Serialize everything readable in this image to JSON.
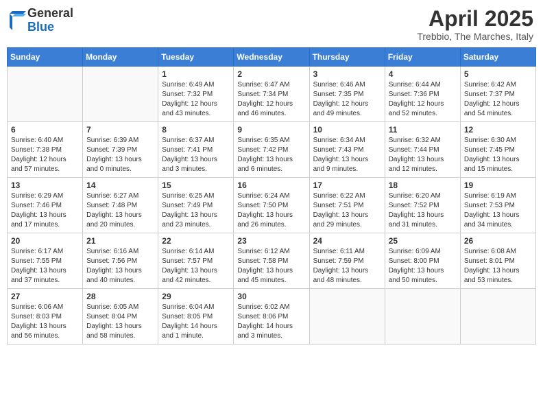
{
  "header": {
    "logo_general": "General",
    "logo_blue": "Blue",
    "month_title": "April 2025",
    "location": "Trebbio, The Marches, Italy"
  },
  "weekdays": [
    "Sunday",
    "Monday",
    "Tuesday",
    "Wednesday",
    "Thursday",
    "Friday",
    "Saturday"
  ],
  "weeks": [
    [
      {
        "day": "",
        "info": ""
      },
      {
        "day": "",
        "info": ""
      },
      {
        "day": "1",
        "info": "Sunrise: 6:49 AM\nSunset: 7:32 PM\nDaylight: 12 hours and 43 minutes."
      },
      {
        "day": "2",
        "info": "Sunrise: 6:47 AM\nSunset: 7:34 PM\nDaylight: 12 hours and 46 minutes."
      },
      {
        "day": "3",
        "info": "Sunrise: 6:46 AM\nSunset: 7:35 PM\nDaylight: 12 hours and 49 minutes."
      },
      {
        "day": "4",
        "info": "Sunrise: 6:44 AM\nSunset: 7:36 PM\nDaylight: 12 hours and 52 minutes."
      },
      {
        "day": "5",
        "info": "Sunrise: 6:42 AM\nSunset: 7:37 PM\nDaylight: 12 hours and 54 minutes."
      }
    ],
    [
      {
        "day": "6",
        "info": "Sunrise: 6:40 AM\nSunset: 7:38 PM\nDaylight: 12 hours and 57 minutes."
      },
      {
        "day": "7",
        "info": "Sunrise: 6:39 AM\nSunset: 7:39 PM\nDaylight: 13 hours and 0 minutes."
      },
      {
        "day": "8",
        "info": "Sunrise: 6:37 AM\nSunset: 7:41 PM\nDaylight: 13 hours and 3 minutes."
      },
      {
        "day": "9",
        "info": "Sunrise: 6:35 AM\nSunset: 7:42 PM\nDaylight: 13 hours and 6 minutes."
      },
      {
        "day": "10",
        "info": "Sunrise: 6:34 AM\nSunset: 7:43 PM\nDaylight: 13 hours and 9 minutes."
      },
      {
        "day": "11",
        "info": "Sunrise: 6:32 AM\nSunset: 7:44 PM\nDaylight: 13 hours and 12 minutes."
      },
      {
        "day": "12",
        "info": "Sunrise: 6:30 AM\nSunset: 7:45 PM\nDaylight: 13 hours and 15 minutes."
      }
    ],
    [
      {
        "day": "13",
        "info": "Sunrise: 6:29 AM\nSunset: 7:46 PM\nDaylight: 13 hours and 17 minutes."
      },
      {
        "day": "14",
        "info": "Sunrise: 6:27 AM\nSunset: 7:48 PM\nDaylight: 13 hours and 20 minutes."
      },
      {
        "day": "15",
        "info": "Sunrise: 6:25 AM\nSunset: 7:49 PM\nDaylight: 13 hours and 23 minutes."
      },
      {
        "day": "16",
        "info": "Sunrise: 6:24 AM\nSunset: 7:50 PM\nDaylight: 13 hours and 26 minutes."
      },
      {
        "day": "17",
        "info": "Sunrise: 6:22 AM\nSunset: 7:51 PM\nDaylight: 13 hours and 29 minutes."
      },
      {
        "day": "18",
        "info": "Sunrise: 6:20 AM\nSunset: 7:52 PM\nDaylight: 13 hours and 31 minutes."
      },
      {
        "day": "19",
        "info": "Sunrise: 6:19 AM\nSunset: 7:53 PM\nDaylight: 13 hours and 34 minutes."
      }
    ],
    [
      {
        "day": "20",
        "info": "Sunrise: 6:17 AM\nSunset: 7:55 PM\nDaylight: 13 hours and 37 minutes."
      },
      {
        "day": "21",
        "info": "Sunrise: 6:16 AM\nSunset: 7:56 PM\nDaylight: 13 hours and 40 minutes."
      },
      {
        "day": "22",
        "info": "Sunrise: 6:14 AM\nSunset: 7:57 PM\nDaylight: 13 hours and 42 minutes."
      },
      {
        "day": "23",
        "info": "Sunrise: 6:12 AM\nSunset: 7:58 PM\nDaylight: 13 hours and 45 minutes."
      },
      {
        "day": "24",
        "info": "Sunrise: 6:11 AM\nSunset: 7:59 PM\nDaylight: 13 hours and 48 minutes."
      },
      {
        "day": "25",
        "info": "Sunrise: 6:09 AM\nSunset: 8:00 PM\nDaylight: 13 hours and 50 minutes."
      },
      {
        "day": "26",
        "info": "Sunrise: 6:08 AM\nSunset: 8:01 PM\nDaylight: 13 hours and 53 minutes."
      }
    ],
    [
      {
        "day": "27",
        "info": "Sunrise: 6:06 AM\nSunset: 8:03 PM\nDaylight: 13 hours and 56 minutes."
      },
      {
        "day": "28",
        "info": "Sunrise: 6:05 AM\nSunset: 8:04 PM\nDaylight: 13 hours and 58 minutes."
      },
      {
        "day": "29",
        "info": "Sunrise: 6:04 AM\nSunset: 8:05 PM\nDaylight: 14 hours and 1 minute."
      },
      {
        "day": "30",
        "info": "Sunrise: 6:02 AM\nSunset: 8:06 PM\nDaylight: 14 hours and 3 minutes."
      },
      {
        "day": "",
        "info": ""
      },
      {
        "day": "",
        "info": ""
      },
      {
        "day": "",
        "info": ""
      }
    ]
  ]
}
